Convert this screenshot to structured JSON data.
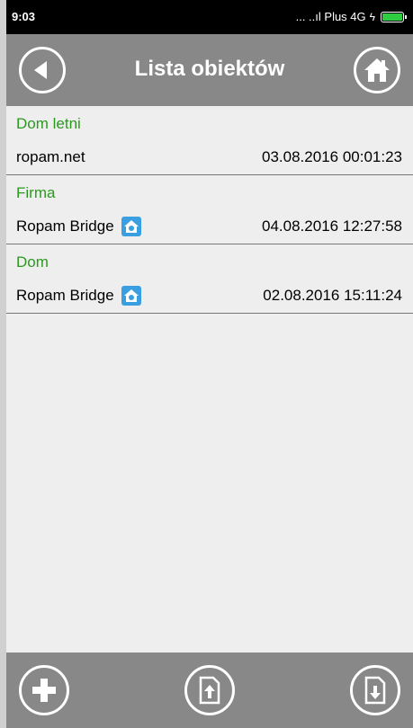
{
  "status_bar": {
    "time": "9:03",
    "carrier": "... ..ıl Plus 4G",
    "battery_color": "#2ecc40"
  },
  "header": {
    "title": "Lista obiektów",
    "back_icon": "back-arrow-icon",
    "home_icon": "home-icon"
  },
  "groups": [
    {
      "name": "Dom letni",
      "items": [
        {
          "label": "ropam.net",
          "date": "03.08.2016 00:01:23",
          "icon": null
        }
      ]
    },
    {
      "name": "Firma",
      "items": [
        {
          "label": "Ropam Bridge",
          "date": "04.08.2016 12:27:58",
          "icon": "ropam-bridge-icon"
        }
      ]
    },
    {
      "name": "Dom",
      "items": [
        {
          "label": "Ropam Bridge",
          "date": "02.08.2016 15:11:24",
          "icon": "ropam-bridge-icon"
        }
      ]
    }
  ],
  "bottom_bar": {
    "buttons": [
      "add-icon",
      "upload-file-icon",
      "download-file-icon"
    ]
  },
  "colors": {
    "bar_background": "#888888",
    "group_header": "#2a9a1e",
    "list_background": "#eeeeee"
  }
}
